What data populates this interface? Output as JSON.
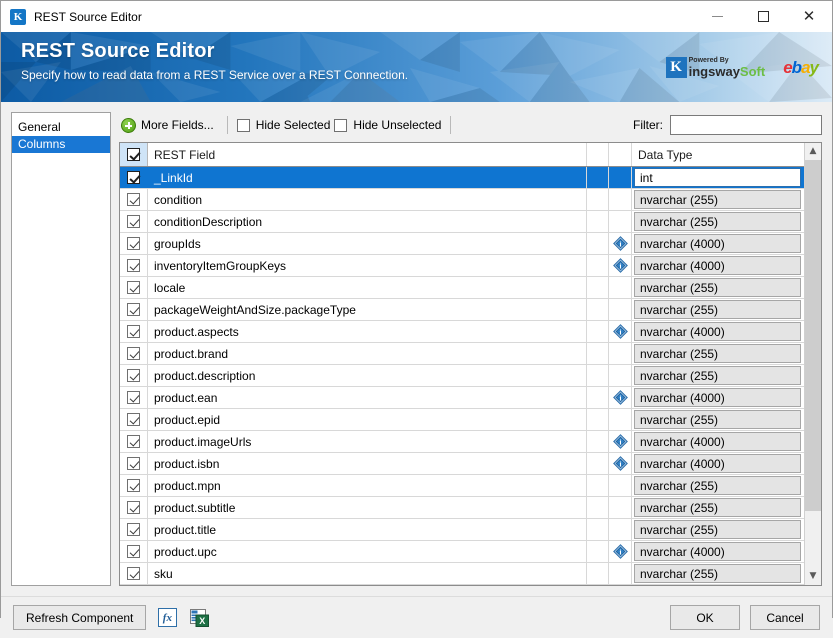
{
  "window": {
    "title": "REST Source Editor",
    "app_icon": "K",
    "minimize_label": "Minimize",
    "maximize_label": "Maximize",
    "close_label": "Close"
  },
  "banner": {
    "title": "REST Source Editor",
    "subtitle": "Specify how to read data from a REST Service over a REST Connection.",
    "logo_kingswaysoft": {
      "mark": "K",
      "powered_by": "Powered By",
      "name_first": "ingsway",
      "name_second": "Soft"
    },
    "logo_ebay": {
      "e": "e",
      "b": "b",
      "a": "a",
      "y": "y"
    },
    "colors": {
      "gradient_start": "#0f5fa8",
      "gradient_end": "#cfe2f3"
    }
  },
  "nav": {
    "items": [
      {
        "label": "General",
        "selected": false
      },
      {
        "label": "Columns",
        "selected": true
      }
    ],
    "selected_color": "#1977d4"
  },
  "toolbar": {
    "more_fields_label": "More Fields...",
    "hide_selected_label": "Hide Selected",
    "hide_selected_checked": false,
    "hide_unselected_label": "Hide Unselected",
    "hide_unselected_checked": false,
    "filter_label": "Filter:",
    "filter_value": "",
    "filter_placeholder": ""
  },
  "grid": {
    "header": {
      "select_all_checked": true,
      "rest_field": "REST Field",
      "data_type": "Data Type"
    },
    "rows": [
      {
        "checked": true,
        "field": "_LinkId",
        "info": false,
        "type": "int",
        "selected": true
      },
      {
        "checked": true,
        "field": "condition",
        "info": false,
        "type": "nvarchar (255)",
        "selected": false
      },
      {
        "checked": true,
        "field": "conditionDescription",
        "info": false,
        "type": "nvarchar (255)",
        "selected": false
      },
      {
        "checked": true,
        "field": "groupIds",
        "info": true,
        "type": "nvarchar (4000)",
        "selected": false
      },
      {
        "checked": true,
        "field": "inventoryItemGroupKeys",
        "info": true,
        "type": "nvarchar (4000)",
        "selected": false
      },
      {
        "checked": true,
        "field": "locale",
        "info": false,
        "type": "nvarchar (255)",
        "selected": false
      },
      {
        "checked": true,
        "field": "packageWeightAndSize.packageType",
        "info": false,
        "type": "nvarchar (255)",
        "selected": false
      },
      {
        "checked": true,
        "field": "product.aspects",
        "info": true,
        "type": "nvarchar (4000)",
        "selected": false
      },
      {
        "checked": true,
        "field": "product.brand",
        "info": false,
        "type": "nvarchar (255)",
        "selected": false
      },
      {
        "checked": true,
        "field": "product.description",
        "info": false,
        "type": "nvarchar (255)",
        "selected": false
      },
      {
        "checked": true,
        "field": "product.ean",
        "info": true,
        "type": "nvarchar (4000)",
        "selected": false
      },
      {
        "checked": true,
        "field": "product.epid",
        "info": false,
        "type": "nvarchar (255)",
        "selected": false
      },
      {
        "checked": true,
        "field": "product.imageUrls",
        "info": true,
        "type": "nvarchar (4000)",
        "selected": false
      },
      {
        "checked": true,
        "field": "product.isbn",
        "info": true,
        "type": "nvarchar (4000)",
        "selected": false
      },
      {
        "checked": true,
        "field": "product.mpn",
        "info": false,
        "type": "nvarchar (255)",
        "selected": false
      },
      {
        "checked": true,
        "field": "product.subtitle",
        "info": false,
        "type": "nvarchar (255)",
        "selected": false
      },
      {
        "checked": true,
        "field": "product.title",
        "info": false,
        "type": "nvarchar (255)",
        "selected": false
      },
      {
        "checked": true,
        "field": "product.upc",
        "info": true,
        "type": "nvarchar (4000)",
        "selected": false
      },
      {
        "checked": true,
        "field": "sku",
        "info": false,
        "type": "nvarchar (255)",
        "selected": false
      }
    ],
    "scroll_up_glyph": "▲",
    "scroll_down_glyph": "▼"
  },
  "footer": {
    "refresh_label": "Refresh Component",
    "fx_label": "fx",
    "export_icon_name": "export-to-excel-icon",
    "ok_label": "OK",
    "cancel_label": "Cancel"
  }
}
